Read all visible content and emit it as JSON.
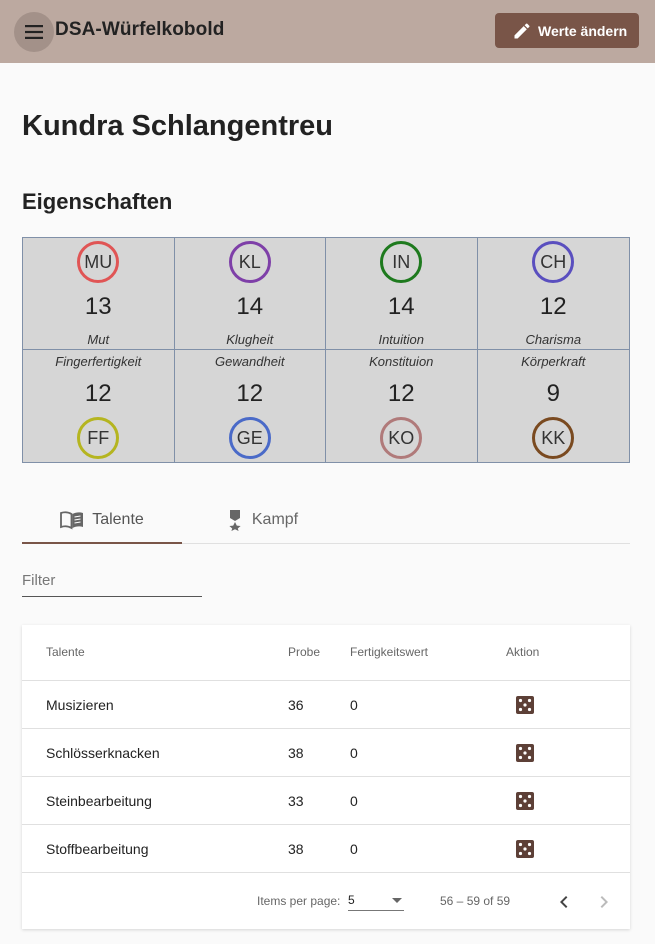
{
  "toolbar": {
    "app_title": "DSA-Würfelkobold",
    "edit_label": "Werte ändern",
    "menu_icon": "menu-icon",
    "edit_icon": "pencil-icon",
    "background_color": "#bca9a0",
    "accent_color": "#795548"
  },
  "character": {
    "name": "Kundra Schlangentreu"
  },
  "attributes": {
    "title": "Eigenschaften",
    "items": [
      {
        "abbr": "MU",
        "value": "13",
        "label": "Mut",
        "color": "#e05555"
      },
      {
        "abbr": "KL",
        "value": "14",
        "label": "Klugheit",
        "color": "#7e3fa8"
      },
      {
        "abbr": "IN",
        "value": "14",
        "label": "Intuition",
        "color": "#1e7a1e"
      },
      {
        "abbr": "CH",
        "value": "12",
        "label": "Charisma",
        "color": "#5a4fbf"
      },
      {
        "abbr": "FF",
        "value": "12",
        "label": "Fingerfertigkeit",
        "color": "#b5b520"
      },
      {
        "abbr": "GE",
        "value": "12",
        "label": "Gewandheit",
        "color": "#4a6ac8"
      },
      {
        "abbr": "KO",
        "value": "12",
        "label": "Konstituion",
        "color": "#b07a7a"
      },
      {
        "abbr": "KK",
        "value": "9",
        "label": "Körperkraft",
        "color": "#7a4a20"
      }
    ]
  },
  "tabs": [
    {
      "label": "Talente",
      "icon": "book-icon",
      "active": true
    },
    {
      "label": "Kampf",
      "icon": "medal-icon",
      "active": false
    }
  ],
  "filter": {
    "placeholder": "Filter",
    "value": ""
  },
  "table": {
    "headers": [
      "Talente",
      "Probe",
      "Fertigkeitswert",
      "Aktion"
    ],
    "rows": [
      {
        "talent": "Musizieren",
        "probe": "36",
        "fw": "0",
        "action_icon": "dice-icon"
      },
      {
        "talent": "Schlösserknacken",
        "probe": "38",
        "fw": "0",
        "action_icon": "dice-icon"
      },
      {
        "talent": "Steinbearbeitung",
        "probe": "33",
        "fw": "0",
        "action_icon": "dice-icon"
      },
      {
        "talent": "Stoffbearbeitung",
        "probe": "38",
        "fw": "0",
        "action_icon": "dice-icon"
      }
    ]
  },
  "paginator": {
    "items_per_page_label": "Items per page:",
    "items_per_page_value": "5",
    "range_label": "56 – 59 of 59",
    "prev_icon": "chevron-left-icon",
    "next_icon": "chevron-right-icon"
  }
}
